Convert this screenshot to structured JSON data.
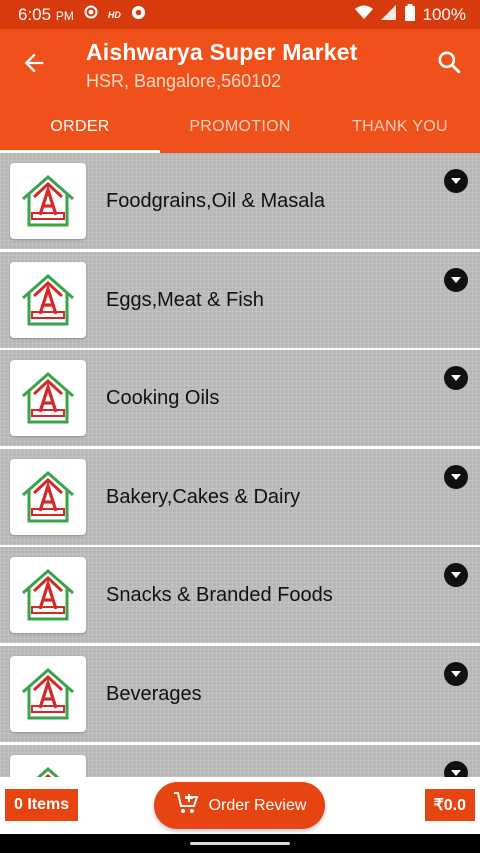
{
  "status_bar": {
    "time": "6:05",
    "ampm": "PM",
    "hd": "HD",
    "battery": "100%"
  },
  "header": {
    "title": "Aishwarya Super Market",
    "subtitle": "HSR, Bangalore,560102",
    "tabs": [
      {
        "label": "ORDER",
        "active": true
      },
      {
        "label": "PROMOTION",
        "active": false
      },
      {
        "label": "THANK YOU",
        "active": false
      }
    ]
  },
  "categories": [
    {
      "label": "Foodgrains,Oil & Masala"
    },
    {
      "label": "Eggs,Meat & Fish"
    },
    {
      "label": "Cooking Oils"
    },
    {
      "label": "Bakery,Cakes & Dairy"
    },
    {
      "label": "Snacks & Branded Foods"
    },
    {
      "label": "Beverages"
    },
    {
      "label": ""
    }
  ],
  "bottom_bar": {
    "items": "0 Items",
    "order_review": "Order Review",
    "amount": "₹0.0"
  },
  "colors": {
    "primary": "#f0501a",
    "status": "#d73b0d",
    "accent": "#e64512"
  }
}
